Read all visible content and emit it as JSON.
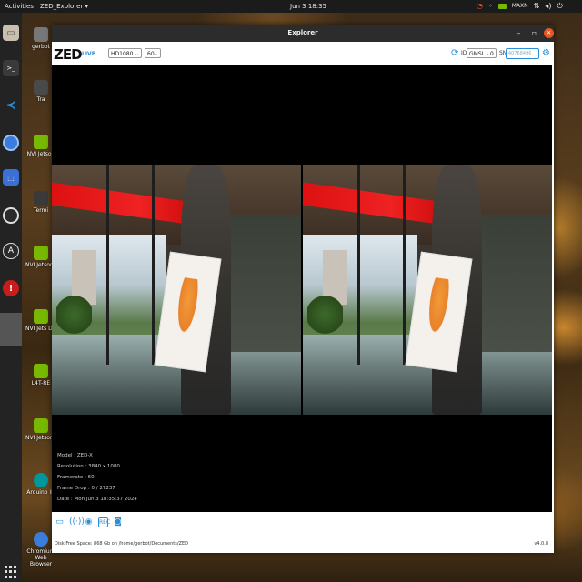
{
  "topbar": {
    "activities": "Activities",
    "app_menu": "ZED_Explorer ▾",
    "clock": "Jun 3  18:35",
    "mode": "MAXN",
    "icons": [
      "system-monitor-icon",
      "nvidia-icon",
      "network-icon",
      "volume-icon",
      "power-icon"
    ]
  },
  "dock": {
    "apps": [
      {
        "name": "files-icon",
        "color": "#9a8a74"
      },
      {
        "name": "terminal-icon",
        "color": "#3a3a3a"
      },
      {
        "name": "vscode-icon",
        "color": "#1e7ed4"
      },
      {
        "name": "chromium-icon",
        "color": "#3b7ddd"
      },
      {
        "name": "screenshot-icon",
        "color": "#2a6ad0"
      },
      {
        "name": "obs-icon",
        "color": "#2a2a2a"
      },
      {
        "name": "arduino-icon",
        "color": "#2a2a2a"
      },
      {
        "name": "warning-app-icon",
        "color": "#c91c1c"
      },
      {
        "name": "running-app-icon",
        "color": "#555555"
      }
    ]
  },
  "desktop": {
    "icons": [
      {
        "label": "gerbot",
        "color": "#777777"
      },
      {
        "label": "Tra",
        "color": "#4a4a4a"
      },
      {
        "label": "NVI Jetson",
        "color": "#76b900"
      },
      {
        "label": "Termi",
        "color": "#3a3a3a"
      },
      {
        "label": "NVI Jetson S Foru",
        "color": "#76b900"
      },
      {
        "label": "NVI Jets Develop",
        "color": "#76b900"
      },
      {
        "label": "L4T-RE",
        "color": "#76b900"
      },
      {
        "label": "NVI Jetson Communit",
        "color": "#76b900"
      },
      {
        "label": "Arduino ID",
        "color": "#00979d"
      },
      {
        "label": "Chromium Web Browser",
        "color": "#3b7ddd"
      }
    ]
  },
  "window": {
    "title": "Explorer",
    "controls": {
      "minimize": "–",
      "maximize": "▫",
      "close": "×"
    }
  },
  "toolbar": {
    "logo": "ZED",
    "live": "LIVE",
    "resolution": "HD1080",
    "fps": "60",
    "id_label": "ID",
    "id_value": "GMSL - 0",
    "sn_label": "SN",
    "sn_value": "40768496"
  },
  "camera_info": {
    "model": "Model : ZED-X",
    "resolution": "Resolution : 3840 x 1080",
    "framerate": "Framerate : 60",
    "frame_drop": "Frame Drop : 0 / 27237",
    "date": "Date : Mon Jun 3 18:35:37 2024"
  },
  "bottombar": {
    "disk_status": "Disk Free Space: 868 Gb  on /home/gerbot/Documents/ZED",
    "version": "v4.0.8",
    "icons": [
      "folder-icon",
      "stream-icon",
      "settings-icon",
      "record-icon",
      "snapshot-icon"
    ],
    "record_label": "REC"
  }
}
